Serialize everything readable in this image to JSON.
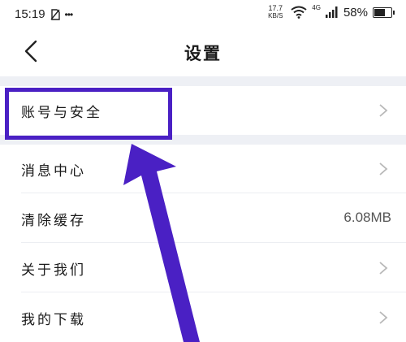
{
  "status_bar": {
    "time": "15:19",
    "notif_icon": "no-sim-notification-icon",
    "more": "•••",
    "net_speed_value": "17.7",
    "net_speed_unit": "KB/S",
    "signal_label": "4G",
    "battery_percent": "58%",
    "battery_level": 0.58
  },
  "header": {
    "title": "设置",
    "back_icon": "chevron-left-icon"
  },
  "settings": {
    "items": [
      {
        "label": "账号与安全",
        "icon": "chevron-right-icon"
      },
      {
        "label": "消息中心",
        "icon": "chevron-right-icon"
      },
      {
        "label": "清除缓存",
        "value": "6.08MB"
      },
      {
        "label": "关于我们",
        "icon": "chevron-right-icon"
      },
      {
        "label": "我的下载",
        "icon": "chevron-right-icon"
      }
    ]
  },
  "annotation": {
    "color": "#4a20c4"
  },
  "colors": {
    "section_gap": "#eef0f5",
    "chevron": "#b8b8b8"
  }
}
